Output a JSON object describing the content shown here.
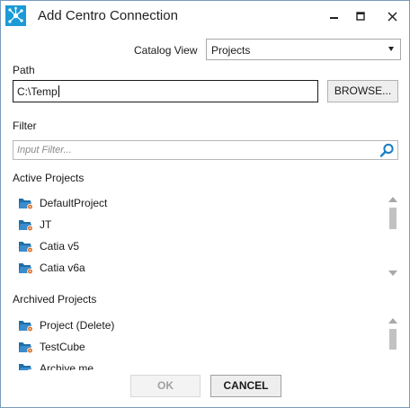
{
  "window": {
    "title": "Add Centro Connection",
    "controls": [
      "minimize-icon",
      "maximize-icon",
      "close-icon"
    ]
  },
  "catalog_view": {
    "label": "Catalog View",
    "selected": "Projects"
  },
  "path": {
    "label": "Path",
    "value": "C:\\Temp",
    "browse_label": "BROWSE..."
  },
  "filter": {
    "label": "Filter",
    "placeholder": "Input Filter...",
    "icon": "search-icon"
  },
  "active_projects": {
    "label": "Active Projects",
    "items": [
      {
        "label": "DefaultProject"
      },
      {
        "label": "JT"
      },
      {
        "label": "Catia v5"
      },
      {
        "label": "Catia v6a"
      }
    ]
  },
  "archived_projects": {
    "label": "Archived Projects",
    "items": [
      {
        "label": "Project (Delete)"
      },
      {
        "label": "TestCube"
      },
      {
        "label": "Archive me"
      }
    ]
  },
  "buttons": {
    "ok": "OK",
    "cancel": "CANCEL"
  },
  "colors": {
    "accent": "#1b9ad6",
    "folder": "#1e6fa8",
    "badge": "#e06a1c"
  }
}
